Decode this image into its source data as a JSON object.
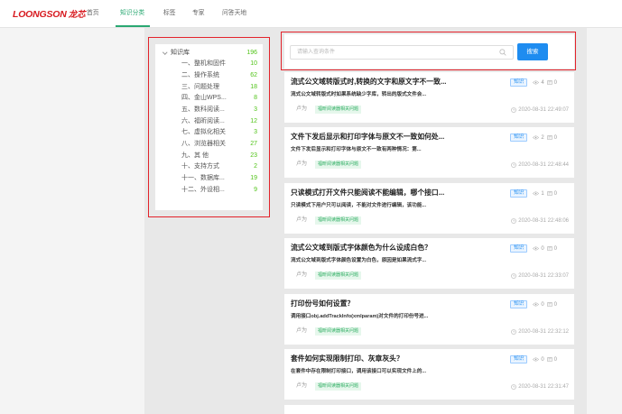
{
  "header": {
    "logo_text": "LOONGSON",
    "logo_cn": "龙芯",
    "nav": [
      {
        "label": "首页",
        "active": false
      },
      {
        "label": "知识分类",
        "active": true
      },
      {
        "label": "标签",
        "active": false
      },
      {
        "label": "专家",
        "active": false
      },
      {
        "label": "问答天地",
        "active": false
      }
    ]
  },
  "sidebar": {
    "root": {
      "label": "知识库",
      "count": "196",
      "expanded": true,
      "icon": "caret-down-icon"
    },
    "items": [
      {
        "label": "一、整机和固件",
        "count": "10"
      },
      {
        "label": "二、操作系统",
        "count": "62"
      },
      {
        "label": "三、问题处理",
        "count": "18"
      },
      {
        "label": "四、金山WPS...",
        "count": "8"
      },
      {
        "label": "五、数科阅读...",
        "count": "3"
      },
      {
        "label": "六、福昕阅读...",
        "count": "12"
      },
      {
        "label": "七、虚拟化相关",
        "count": "3"
      },
      {
        "label": "八、浏览器相关",
        "count": "27"
      },
      {
        "label": "九、其 他",
        "count": "23"
      },
      {
        "label": "十、支持方式",
        "count": "2"
      },
      {
        "label": "十一、数据库...",
        "count": "19"
      },
      {
        "label": "十二、外设相...",
        "count": "9"
      }
    ]
  },
  "search": {
    "placeholder": "请输入查询条件",
    "value": "",
    "icon": "search-icon",
    "button_label": "搜索"
  },
  "articles": [
    {
      "title": "流式公文域转版式时,转换的文字和原文字不一致...",
      "badge": "知识",
      "views": "4",
      "comments": "0",
      "summary": "流式公文域转版式时如果系统缺少字库，转出的版式文件会...",
      "author": "卢为",
      "tag": "福昕阅读器相关问题",
      "date": "2020-08-31 22:49:07"
    },
    {
      "title": "文件下发后显示和打印字体与原文不一致如何处...",
      "badge": "知识",
      "views": "2",
      "comments": "0",
      "summary": "文件下发后显示和打印字体与原文不一致有两种情况：第...",
      "author": "卢为",
      "tag": "福昕阅读器相关问题",
      "date": "2020-08-31 22:48:44"
    },
    {
      "title": "只读模式打开文件只能阅读不能编辑，哪个接口...",
      "badge": "知识",
      "views": "1",
      "comments": "0",
      "summary": "只读模式下用户只可以阅读，不能对文件进行编辑，该功能...",
      "author": "卢为",
      "tag": "福昕阅读器相关问题",
      "date": "2020-08-31 22:48:06"
    },
    {
      "title": "流式公文域到版式字体颜色为什么设成白色？",
      "badge": "知识",
      "views": "0",
      "comments": "0",
      "summary": "流式公文域到版式字体颜色设置为白色，原因是如果流式字...",
      "author": "卢为",
      "tag": "福昕阅读器相关问题",
      "date": "2020-08-31 22:33:07"
    },
    {
      "title": "打印份号如何设置？",
      "badge": "知识",
      "views": "0",
      "comments": "0",
      "summary": "调用接口obj.addTrackInfo(xmlparam)对文件的打印份号进...",
      "author": "卢为",
      "tag": "福昕阅读器相关问题",
      "date": "2020-08-31 22:32:12"
    },
    {
      "title": "套件如何实现限制打印、灰章灰头？",
      "badge": "知识",
      "views": "0",
      "comments": "0",
      "summary": "在套件中存在限制打印接口，调用该接口可以实现文件上的...",
      "author": "卢为",
      "tag": "福昕阅读器相关问题",
      "date": "2020-08-31 22:31:47"
    }
  ],
  "icons": {
    "search": "search-icon",
    "views": "eye-icon",
    "comments": "comment-icon",
    "date": "clock-icon",
    "tree_toggle": "caret-down-icon"
  },
  "colors": {
    "brand_red": "#d7191f",
    "nav_active": "#2aa872",
    "count_green": "#52c41a",
    "primary_blue": "#1e8cf0",
    "tag_green": "#2fae63",
    "highlight_red": "#e3232b",
    "page_bg": "#f4f4f4",
    "column_bg": "#e8e8e8"
  }
}
